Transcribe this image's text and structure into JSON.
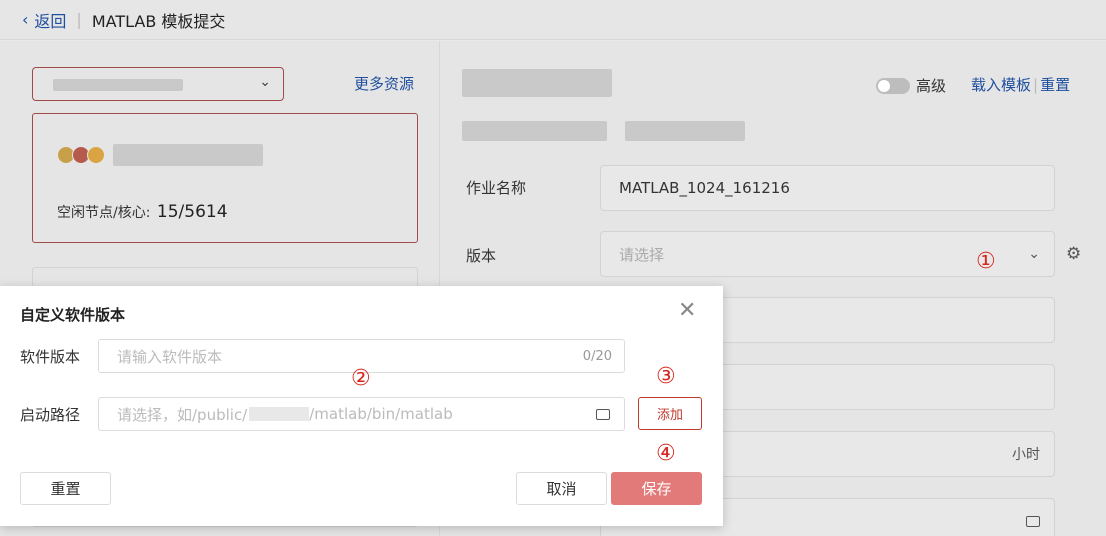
{
  "topbar": {
    "back_label": "返回",
    "title": "MATLAB 模板提交"
  },
  "left": {
    "more_link": "更多资源",
    "idle_label": "空闲节点/核心:",
    "idle_value": "15/5614"
  },
  "right": {
    "advanced_label": "高级",
    "load_template": "载入模板",
    "reset": "重置",
    "job_name_label": "作业名称",
    "job_name_value": "MATLAB_1024_161216",
    "version_label": "版本",
    "version_placeholder": "请选择",
    "hours_unit": "小时"
  },
  "dialog": {
    "title": "自定义软件版本",
    "version_label": "软件版本",
    "version_placeholder": "请输入软件版本",
    "version_counter": "0/20",
    "path_label": "启动路径",
    "path_placeholder_pre": "请选择，如/public/",
    "path_placeholder_post": "/matlab/bin/matlab",
    "add_label": "添加",
    "reset_label": "重置",
    "cancel_label": "取消",
    "save_label": "保存"
  },
  "annotations": [
    "①",
    "②",
    "③",
    "④"
  ],
  "colors": {
    "link": "#1f4f9e",
    "accent_red": "#c0392b",
    "save_button": "#e37a7a",
    "annotation": "#d7281f"
  },
  "icons": [
    "chevron-left-icon",
    "chevron-down-icon",
    "gear-icon",
    "close-icon",
    "folder-icon"
  ]
}
